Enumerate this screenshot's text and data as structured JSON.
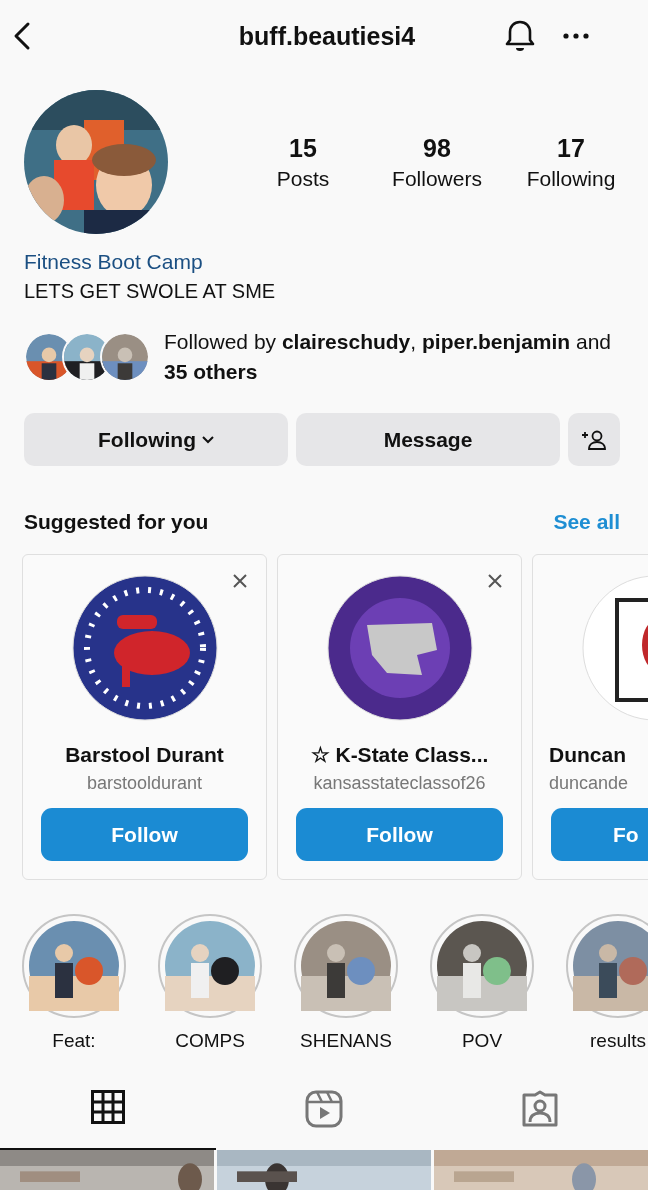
{
  "header": {
    "username": "buff.beautiesi4"
  },
  "stats": [
    {
      "value": "15",
      "label": "Posts"
    },
    {
      "value": "98",
      "label": "Followers"
    },
    {
      "value": "17",
      "label": "Following"
    }
  ],
  "bio": {
    "category": "Fitness Boot Camp",
    "text": "LETS GET SWOLE AT SME"
  },
  "followed_by": "Followed by **claireschudy**, **piper.benjamin** and **35 others**",
  "buttons": {
    "following": "Following",
    "message": "Message"
  },
  "suggested": {
    "title": "Suggested for you",
    "see_all": "See all",
    "cards": [
      {
        "name": "Barstool Durant",
        "handle": "barstooldurant",
        "button": "Follow"
      },
      {
        "name": "☆ K-State Class...",
        "handle": "kansasstateclassof26",
        "button": "Follow"
      },
      {
        "name": "Duncan",
        "handle": "duncande",
        "button": "Fo"
      }
    ]
  },
  "highlights": [
    {
      "label": "Feat:"
    },
    {
      "label": "COMPS"
    },
    {
      "label": "SHENANS"
    },
    {
      "label": "POV"
    },
    {
      "label": "results"
    }
  ],
  "tabs": [
    {
      "kind": "grid",
      "selected": true
    },
    {
      "kind": "reels",
      "selected": false
    },
    {
      "kind": "tagged",
      "selected": false
    }
  ]
}
